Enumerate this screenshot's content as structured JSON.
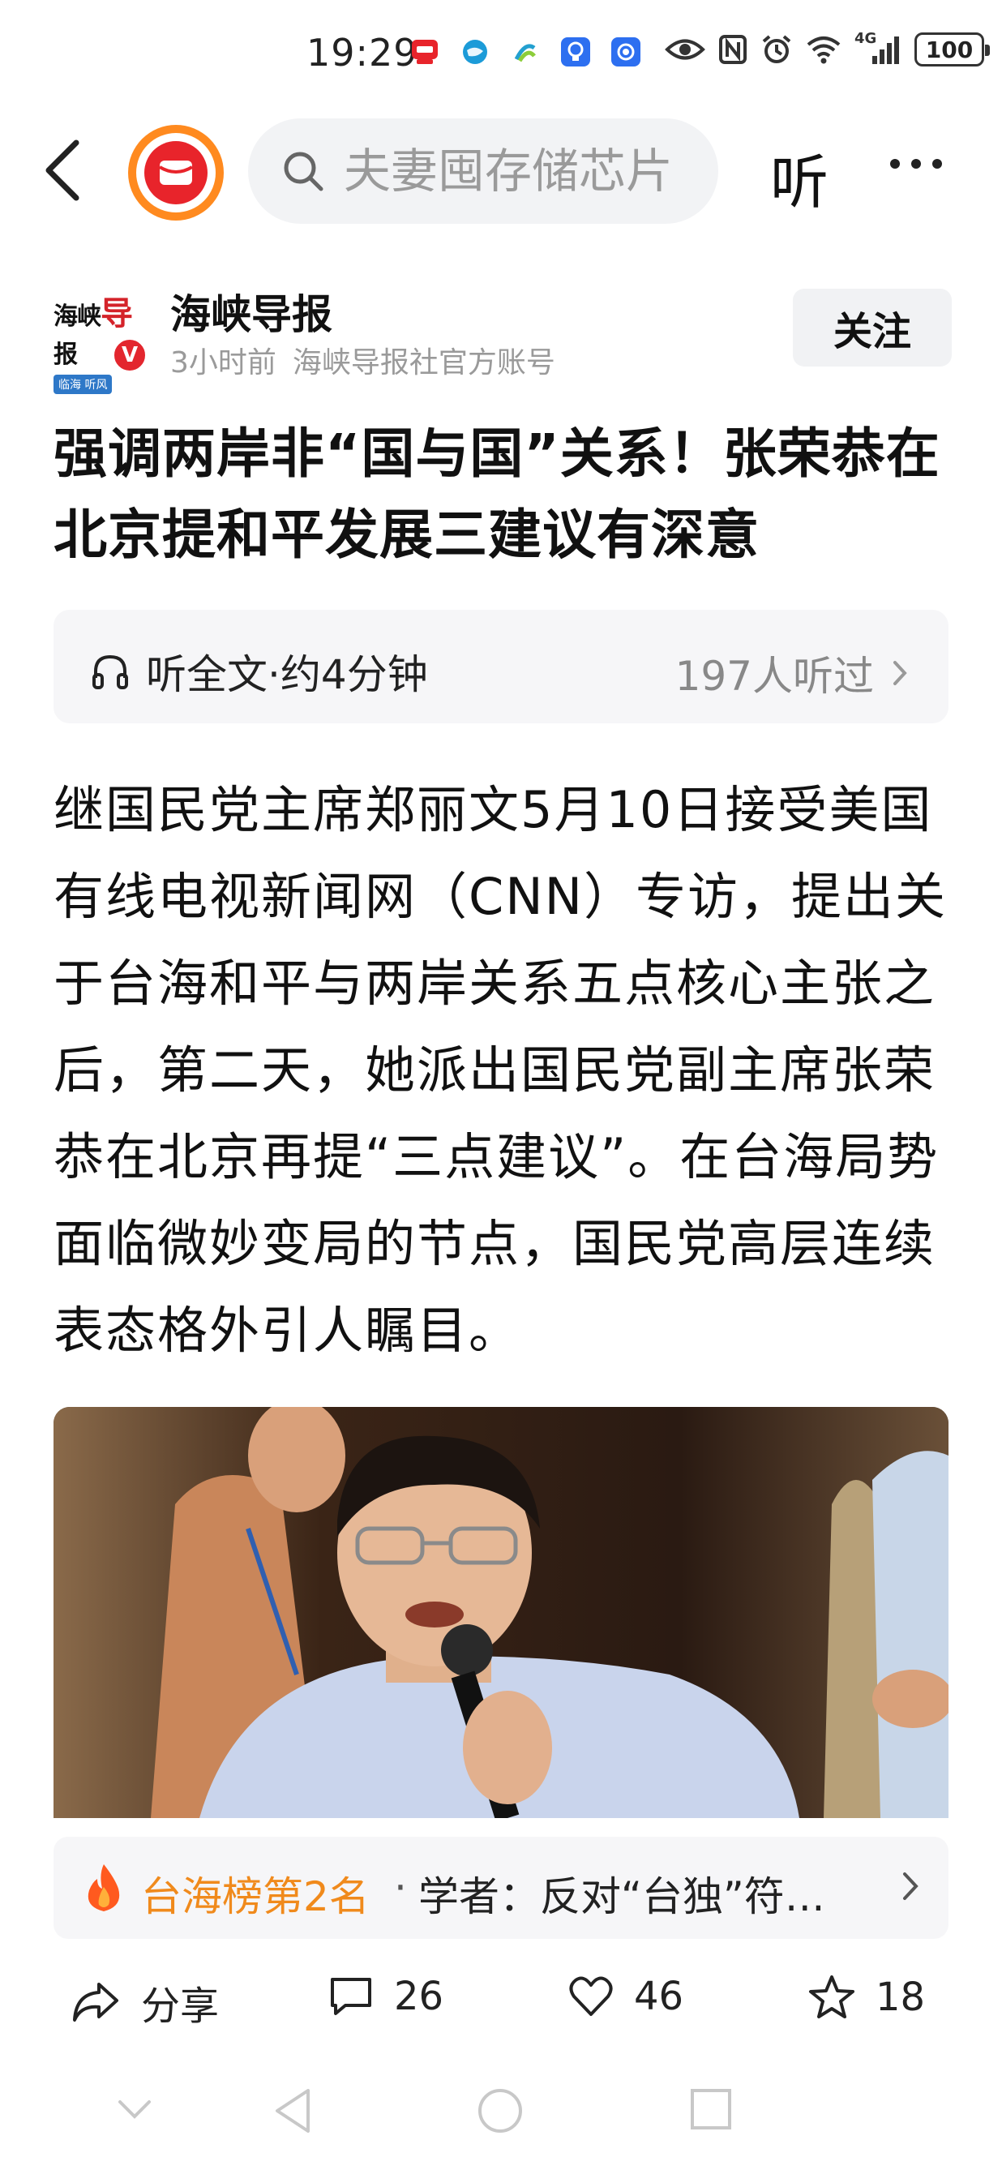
{
  "status_bar": {
    "time": "19:29",
    "network": "4G",
    "battery": "100"
  },
  "nav": {
    "search_placeholder": "夫妻囤存储芯片",
    "listen_label": "听"
  },
  "author": {
    "avatar_brand": "海峡",
    "avatar_brand_red": "导",
    "avatar_brand_tail": "报",
    "avatar_sub": "临海 听风",
    "verified": "V",
    "name": "海峡导报",
    "time": "3小时前",
    "description": "海峡导报社官方账号",
    "follow_label": "关注"
  },
  "article": {
    "title": "强调两岸非“国与国”关系！张荣恭在北京提和平发展三建议有深意",
    "listen_bar": {
      "label": "听全文·约4分钟",
      "count": "197人听过"
    },
    "body": "继国民党主席郑丽文5月10日接受美国有线电视新闻网（CNN）专访，提出关于台海和平与两岸关系五点核心主张之后，第二天，她派出国民党副主席张荣恭在北京再提“三点建议”。在台海局势面临微妙变局的节点，国民党高层连续表态格外引人瞩目。"
  },
  "rank": {
    "title": "台海榜第2名",
    "separator": "·",
    "text": "学者：反对“台独”符…"
  },
  "actions": {
    "share": "分享",
    "comments": "26",
    "likes": "46",
    "favorites": "18"
  },
  "colors": {
    "accent_orange": "#f08a1c",
    "logo_red": "#e8242b",
    "verified_red": "#e3262e"
  }
}
